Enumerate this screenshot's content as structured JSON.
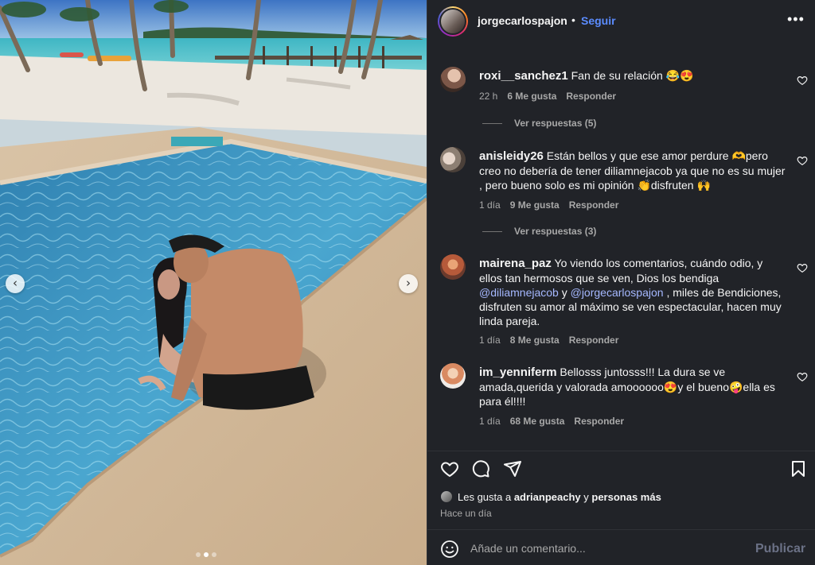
{
  "post": {
    "author": "jorgecarlospajon",
    "separator": "•",
    "follow_label": "Seguir",
    "more_label": "•••"
  },
  "media": {
    "prev_label": "‹",
    "next_label": "›",
    "slide_count": 3,
    "active_slide": 2
  },
  "comments": [
    {
      "user": "roxi__sanchez1",
      "text": " Fan de su relación 😂😍",
      "time": "22 h",
      "likes": "6 Me gusta",
      "reply_label": "Responder",
      "replies_label": "Ver respuestas (5)",
      "avatar_color": "#b88f7a"
    },
    {
      "user": "anisleidy26",
      "text": " Están bellos y que ese amor perdure 🫶pero creo no debería de tener diliamnejacob ya que no es su mujer , pero bueno solo es mi opinión 👏disfruten 🙌",
      "time": "1 día",
      "likes": "9 Me gusta",
      "reply_label": "Responder",
      "replies_label": "Ver respuestas (3)",
      "avatar_color": "#9a8b80"
    },
    {
      "user": "mairena_paz",
      "text_before": " Yo viendo los comentarios, cuándo odio, y ellos tan hermosos que se ven, Dios los bendiga ",
      "mention1": "@diliamnejacob",
      "text_mid": " y ",
      "mention2": "@jorgecarlospajon",
      "text_after": " , miles de Bendiciones, disfruten su amor al máximo se ven espectacular, hacen muy linda pareja.",
      "time": "1 día",
      "likes": "8 Me gusta",
      "reply_label": "Responder",
      "avatar_color": "#c0714e"
    },
    {
      "user": "im_yenniferm",
      "text": " Bellosss juntosss!!! La dura se ve amada,querida y valorada amoooooo😍y el bueno🤪ella es para él!!!!",
      "time": "1 día",
      "likes": "68 Me gusta",
      "reply_label": "Responder",
      "avatar_color": "#d9a07f"
    }
  ],
  "actions": {
    "liked_by_prefix": "Les gusta a ",
    "liked_by_user": "adrianpeachy",
    "liked_by_mid": " y ",
    "liked_by_rest": "personas más",
    "time_ago": "Hace un día"
  },
  "composer": {
    "placeholder": "Añade un comentario...",
    "publish_label": "Publicar"
  },
  "colors": {
    "panel_bg": "#212328",
    "link_blue": "#5b8cff",
    "mention": "#a5b8ff"
  }
}
